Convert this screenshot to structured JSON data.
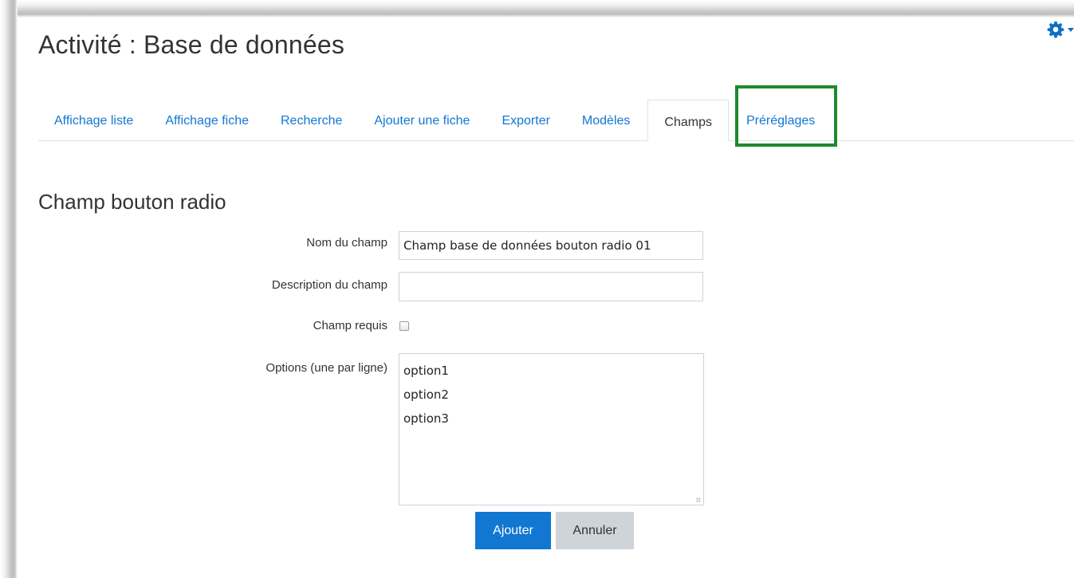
{
  "page": {
    "title": "Activité : Base de données"
  },
  "settings": {
    "icon": "gear-icon",
    "color": "#0f6fc5"
  },
  "tabs": [
    {
      "label": "Affichage liste",
      "active": false
    },
    {
      "label": "Affichage fiche",
      "active": false
    },
    {
      "label": "Recherche",
      "active": false
    },
    {
      "label": "Ajouter une fiche",
      "active": false
    },
    {
      "label": "Exporter",
      "active": false
    },
    {
      "label": "Modèles",
      "active": false
    },
    {
      "label": "Champs",
      "active": true
    },
    {
      "label": "Préréglages",
      "active": false
    }
  ],
  "highlight_color": "#1e8a2e",
  "form": {
    "section_title": "Champ bouton radio",
    "name_label": "Nom du champ",
    "name_value": "Champ base de données bouton radio 01",
    "description_label": "Description du champ",
    "description_value": "",
    "required_label": "Champ requis",
    "required_checked": false,
    "options_label": "Options (une par ligne)",
    "options": [
      "option1",
      "option2",
      "option3"
    ],
    "submit_label": "Ajouter",
    "cancel_label": "Annuler"
  },
  "colors": {
    "link": "#1177d1",
    "primary": "#1177d1",
    "secondary": "#ced4da"
  }
}
